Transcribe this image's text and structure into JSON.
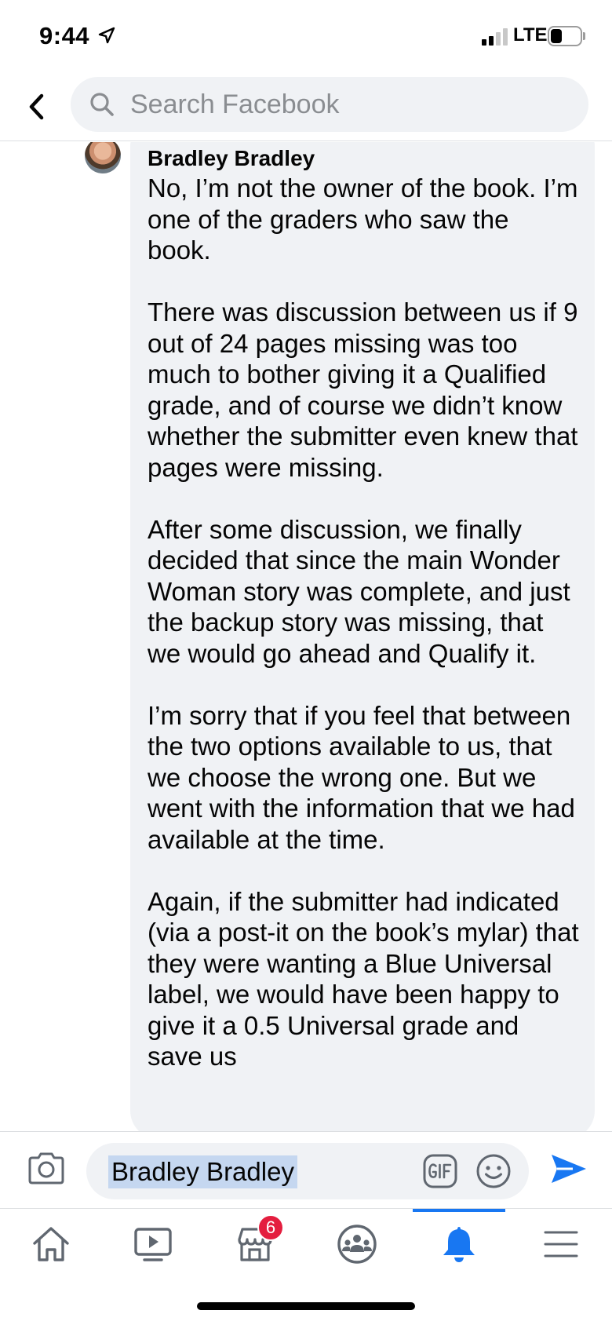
{
  "status_bar": {
    "time": "9:44",
    "network": "LTE",
    "battery_level": 0.4
  },
  "header": {
    "back_icon": "chevron-left-icon",
    "search": {
      "placeholder": "Search Facebook",
      "value": ""
    }
  },
  "comment": {
    "author": "Bradley  Bradley",
    "paragraphs": [
      "No, I’m not the owner of the book. I’m one of the graders who saw the book.",
      "There was discussion between us if 9 out of 24 pages missing was too much to bother giving it a Qualified grade, and of course we didn’t know whether the submitter even knew that pages were missing.",
      "After some discussion, we finally decided that since the main Wonder Woman story was complete, and just the backup story was missing, that we would go ahead and Qualify it.",
      "I’m sorry that if you feel that between the two options available to us, that we choose the wrong one. But we went with the information that we had available at the time.",
      "Again, if the submitter had indicated (via a post-it on the book’s mylar) that they were wanting a Blue Universal label, we would have been happy to give it a 0.5 Universal grade and save us"
    ]
  },
  "composer": {
    "mention": "Bradley  Bradley",
    "icons": [
      "camera-icon",
      "gif-icon",
      "emoji-icon",
      "send-icon"
    ]
  },
  "tabbar": {
    "tabs": [
      {
        "icon": "home-icon"
      },
      {
        "icon": "video-icon"
      },
      {
        "icon": "marketplace-icon",
        "badge": "6"
      },
      {
        "icon": "groups-icon"
      },
      {
        "icon": "notifications-icon",
        "active": true
      },
      {
        "icon": "menu-icon"
      }
    ]
  },
  "colors": {
    "accent": "#1877f2",
    "badge": "#e41e3f",
    "bubble": "#f0f2f5",
    "mention_highlight": "#c5d7f0",
    "icon_gray": "#606770"
  }
}
